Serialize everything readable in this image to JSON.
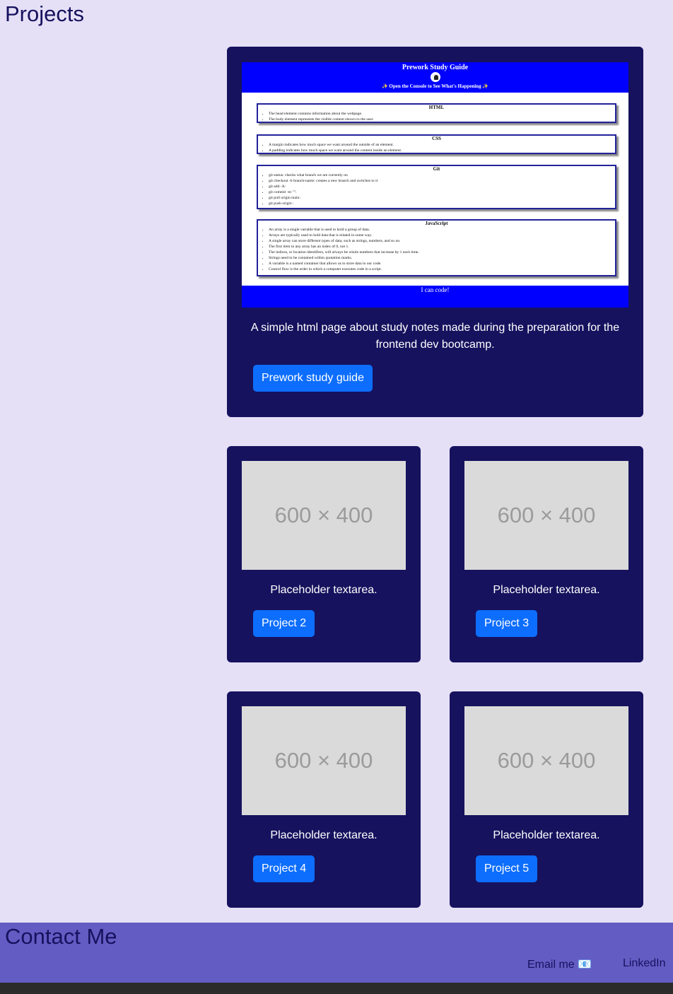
{
  "projects": {
    "title": "Projects",
    "featured": {
      "screenshot": {
        "title": "Prework Study Guide",
        "subtitle": "✨ Open the Console to See What's Happening ✨",
        "sections": [
          {
            "heading": "HTML",
            "items": [
              "The head element contains information about the webpage.",
              "The body element represents the visible content shown to the user."
            ]
          },
          {
            "heading": "CSS",
            "items": [
              "A margin indicates how much space we want around the outside of an element.",
              "A padding indicates how much space we want around the content inside an element."
            ]
          },
          {
            "heading": "Git",
            "items": [
              "git status: checks what branch we are currently on",
              "git checkout -b branch-name: creates a new branch and switches to it",
              "git add -A:",
              "git commit -m \"\":",
              "git pull origin main:",
              "git push origin :"
            ]
          },
          {
            "heading": "JavaScript",
            "items": [
              "An array is a single variable that is used to hold a group of data.",
              "Arrays are typically used to hold data that is related in some way.",
              "A single array can store different types of data, such as strings, numbers, and so on.",
              "The first item in any array has an index of 0, not 1.",
              "The indices, or location identifiers, will always be whole numbers that increase by 1 each time.",
              "Strings need to be contained within quotation marks.",
              "A variable is a named container that allows us to store data in our code.",
              "Control flow is the order in which a computer executes code in a script."
            ]
          }
        ],
        "footer": "I can code!"
      },
      "description": "A simple html page about study notes made during the preparation for the frontend dev bootcamp.",
      "button": "Prework study guide"
    },
    "cards": [
      {
        "placeholder": "600 × 400",
        "text": "Placeholder textarea.",
        "button": "Project 2"
      },
      {
        "placeholder": "600 × 400",
        "text": "Placeholder textarea.",
        "button": "Project 3"
      },
      {
        "placeholder": "600 × 400",
        "text": "Placeholder textarea.",
        "button": "Project 4"
      },
      {
        "placeholder": "600 × 400",
        "text": "Placeholder textarea.",
        "button": "Project 5"
      }
    ]
  },
  "contact": {
    "title": "Contact Me",
    "email": "Email me 📧",
    "linkedin": "LinkedIn"
  },
  "colors": {
    "background": "#e6e0f7",
    "card": "#16125e",
    "button": "#0d6efd",
    "contact_bar": "#635cc3"
  }
}
